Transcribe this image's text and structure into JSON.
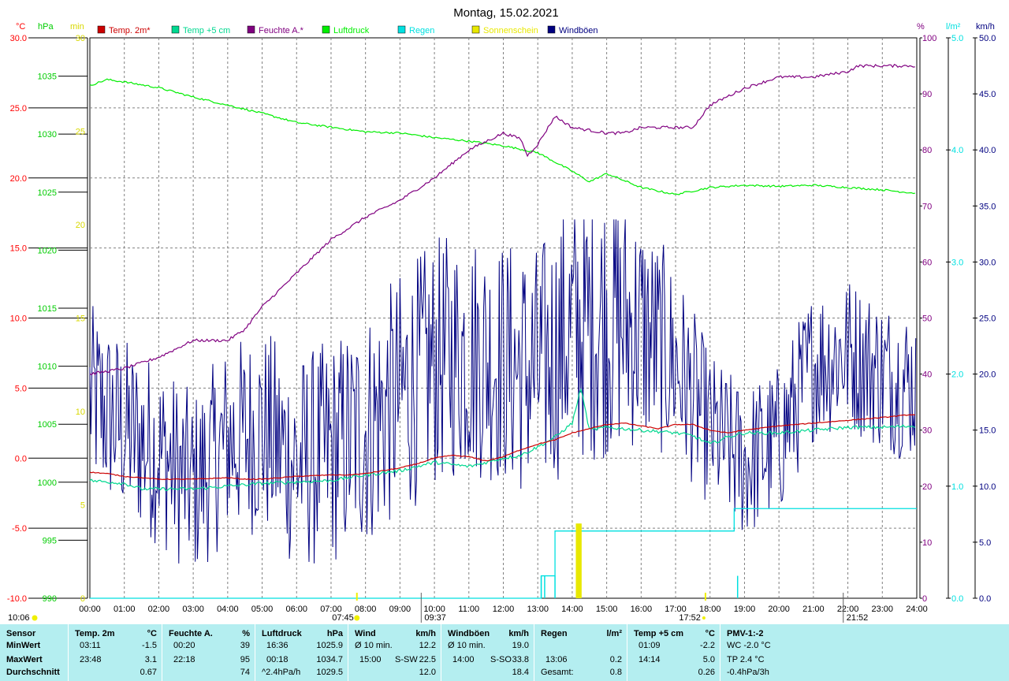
{
  "title": "Montag, 15.02.2021",
  "axes": {
    "temp": {
      "unit": "°C",
      "color": "#ff0000",
      "ticks": [
        30,
        25,
        20,
        15,
        10,
        5,
        0,
        -5,
        -10
      ],
      "labels": [
        "30.0",
        "25.0",
        "20.0",
        "15.0",
        "10.0",
        "5.0",
        "0.0",
        "-5.0",
        "-10.0"
      ]
    },
    "pressure": {
      "unit": "hPa",
      "color": "#00cc00",
      "ticks": [
        1035,
        1030,
        1025,
        1020,
        1015,
        1010,
        1005,
        1000,
        995,
        990
      ],
      "labels": [
        "1035",
        "1030",
        "1025",
        "1020",
        "1015",
        "1010",
        "1005",
        "1000",
        "995",
        "990"
      ]
    },
    "sun": {
      "unit": "min",
      "color": "#e8e800",
      "ticks": [
        30,
        25,
        20,
        15,
        10,
        5,
        0
      ],
      "labels": [
        "30",
        "25",
        "20",
        "15",
        "10",
        "5",
        "0"
      ]
    },
    "humidity": {
      "unit": "%",
      "color": "#800080",
      "ticks": [
        100,
        90,
        80,
        70,
        60,
        50,
        40,
        30,
        20,
        10,
        0
      ],
      "labels": [
        "100",
        "90",
        "80",
        "70",
        "60",
        "50",
        "40",
        "30",
        "20",
        "10",
        "0"
      ]
    },
    "rain": {
      "unit": "l/m²",
      "color": "#00e0e0",
      "ticks": [
        5,
        4,
        3,
        2,
        1,
        0
      ],
      "labels": [
        "5.0",
        "4.0",
        "3.0",
        "2.0",
        "1.0",
        "0.0"
      ]
    },
    "wind": {
      "unit": "km/h",
      "color": "#000080",
      "ticks": [
        50,
        45,
        40,
        35,
        30,
        25,
        20,
        15,
        10,
        5,
        0
      ],
      "labels": [
        "50.0",
        "45.0",
        "40.0",
        "35.0",
        "30.0",
        "25.0",
        "20.0",
        "15.0",
        "10.0",
        "5.0",
        "0.0"
      ]
    }
  },
  "x_labels": [
    "00:00",
    "01:00",
    "02:00",
    "03:00",
    "04:00",
    "05:00",
    "06:00",
    "07:00",
    "08:00",
    "09:00",
    "10:00",
    "11:00",
    "12:00",
    "13:00",
    "14:00",
    "15:00",
    "16:00",
    "17:00",
    "18:00",
    "19:00",
    "20:00",
    "21:00",
    "22:00",
    "23:00",
    "24:00"
  ],
  "sun_events": {
    "moonrise": "10:06",
    "sunrise": "07:45",
    "transit": "09:37",
    "sunset": "17:52",
    "moonset": "21:52"
  },
  "chart_data": {
    "type": "line",
    "x_range": [
      0,
      24
    ],
    "grid": true,
    "legend_position": "top",
    "series": [
      {
        "name": "Temp. 2m*",
        "axis": "temp",
        "color": "#cc0000",
        "points": [
          [
            0,
            -1.0
          ],
          [
            0.5,
            -1.1
          ],
          [
            1,
            -1.3
          ],
          [
            1.5,
            -1.4
          ],
          [
            2,
            -1.5
          ],
          [
            3,
            -1.5
          ],
          [
            4,
            -1.4
          ],
          [
            4.5,
            -1.5
          ],
          [
            5,
            -1.5
          ],
          [
            6,
            -1.3
          ],
          [
            7,
            -1.2
          ],
          [
            7.5,
            -1.2
          ],
          [
            8,
            -1.1
          ],
          [
            8.5,
            -0.9
          ],
          [
            9,
            -0.7
          ],
          [
            9.5,
            -0.4
          ],
          [
            10,
            0.0
          ],
          [
            10.5,
            0.2
          ],
          [
            11,
            0.1
          ],
          [
            11.5,
            -0.2
          ],
          [
            12,
            0.1
          ],
          [
            12.5,
            0.6
          ],
          [
            13,
            1.0
          ],
          [
            13.5,
            1.3
          ],
          [
            14,
            1.8
          ],
          [
            14.5,
            2.1
          ],
          [
            15,
            2.4
          ],
          [
            15.5,
            2.5
          ],
          [
            16,
            2.3
          ],
          [
            16.5,
            2.1
          ],
          [
            17,
            2.4
          ],
          [
            17.5,
            2.4
          ],
          [
            18,
            2.0
          ],
          [
            18.5,
            1.8
          ],
          [
            19,
            2.0
          ],
          [
            20,
            2.3
          ],
          [
            21,
            2.5
          ],
          [
            22,
            2.7
          ],
          [
            23,
            2.9
          ],
          [
            23.8,
            3.1
          ],
          [
            24,
            3.1
          ]
        ]
      },
      {
        "name": "Temp +5 cm",
        "axis": "temp",
        "color": "#00d890",
        "points": [
          [
            0,
            -1.6
          ],
          [
            1,
            -1.8
          ],
          [
            1.5,
            -2.2
          ],
          [
            2,
            -2.2
          ],
          [
            3,
            -2.2
          ],
          [
            4,
            -2.0
          ],
          [
            5,
            -1.8
          ],
          [
            6,
            -1.7
          ],
          [
            7,
            -1.6
          ],
          [
            8,
            -1.2
          ],
          [
            9,
            -0.9
          ],
          [
            10,
            -0.3
          ],
          [
            11,
            -0.6
          ],
          [
            12,
            0.0
          ],
          [
            12.5,
            0.2
          ],
          [
            13,
            0.8
          ],
          [
            13.5,
            1.5
          ],
          [
            14,
            2.5
          ],
          [
            14.25,
            5.0
          ],
          [
            14.5,
            2.0
          ],
          [
            15,
            2.2
          ],
          [
            16,
            2.0
          ],
          [
            17,
            1.8
          ],
          [
            17.5,
            1.6
          ],
          [
            18,
            1.0
          ],
          [
            18.5,
            1.5
          ],
          [
            19,
            1.8
          ],
          [
            20,
            1.8
          ],
          [
            21,
            2.0
          ],
          [
            22,
            2.2
          ],
          [
            23,
            2.2
          ],
          [
            24,
            2.3
          ]
        ]
      },
      {
        "name": "Feuchte A.*",
        "axis": "humidity",
        "color": "#800080",
        "points": [
          [
            0,
            40
          ],
          [
            1,
            41
          ],
          [
            2,
            43
          ],
          [
            3,
            46
          ],
          [
            4,
            46
          ],
          [
            4.5,
            48
          ],
          [
            5,
            52
          ],
          [
            6,
            58
          ],
          [
            7,
            64
          ],
          [
            8,
            68
          ],
          [
            9,
            71
          ],
          [
            10,
            75
          ],
          [
            11,
            80
          ],
          [
            12,
            83
          ],
          [
            12.5,
            82
          ],
          [
            12.7,
            79
          ],
          [
            13,
            81
          ],
          [
            13.5,
            86
          ],
          [
            14,
            84
          ],
          [
            15,
            83
          ],
          [
            15.5,
            83
          ],
          [
            16,
            84
          ],
          [
            17,
            84
          ],
          [
            17.5,
            84
          ],
          [
            18,
            88
          ],
          [
            19,
            91
          ],
          [
            20,
            93
          ],
          [
            21,
            93
          ],
          [
            22,
            94
          ],
          [
            22.3,
            95
          ],
          [
            24,
            95
          ]
        ]
      },
      {
        "name": "Luftdruck",
        "axis": "pressure",
        "color": "#00ee00",
        "points": [
          [
            0,
            1034.2
          ],
          [
            0.5,
            1034.7
          ],
          [
            1,
            1034.5
          ],
          [
            2,
            1034.0
          ],
          [
            3,
            1033.2
          ],
          [
            4,
            1032.5
          ],
          [
            5,
            1031.8
          ],
          [
            6,
            1031.0
          ],
          [
            7,
            1030.6
          ],
          [
            8,
            1030.2
          ],
          [
            9,
            1030.1
          ],
          [
            10,
            1029.7
          ],
          [
            11,
            1029.4
          ],
          [
            12,
            1029.0
          ],
          [
            13,
            1028.4
          ],
          [
            14,
            1026.8
          ],
          [
            14.5,
            1025.9
          ],
          [
            15,
            1026.6
          ],
          [
            16,
            1025.4
          ],
          [
            17,
            1024.8
          ],
          [
            18,
            1025.4
          ],
          [
            19,
            1025.6
          ],
          [
            20,
            1025.5
          ],
          [
            21,
            1025.6
          ],
          [
            22,
            1025.4
          ],
          [
            23,
            1025.2
          ],
          [
            24,
            1024.9
          ]
        ]
      },
      {
        "name": "Regen",
        "axis": "rain",
        "color": "#00e0e0",
        "cumulative": [
          [
            0,
            0
          ],
          [
            13.1,
            0
          ],
          [
            13.1,
            0.2
          ],
          [
            13.5,
            0.2
          ],
          [
            13.5,
            0.6
          ],
          [
            18.7,
            0.6
          ],
          [
            18.7,
            0.8
          ],
          [
            24,
            0.8
          ]
        ],
        "spikes": [
          [
            13.1,
            0.2
          ],
          [
            13.2,
            0.2
          ],
          [
            13.5,
            0.2
          ],
          [
            18.8,
            0.2
          ]
        ]
      },
      {
        "name": "Sonnenschein",
        "axis": "sun",
        "color": "#e8e800",
        "bars": [
          [
            14.15,
            4
          ],
          [
            14.2,
            4
          ],
          [
            14.25,
            4
          ]
        ]
      },
      {
        "name": "Windböen",
        "axis": "wind",
        "color": "#000080",
        "baseline": [
          [
            0,
            18
          ],
          [
            1,
            15
          ],
          [
            2,
            13
          ],
          [
            3,
            10
          ],
          [
            4,
            14
          ],
          [
            5,
            15
          ],
          [
            6,
            12
          ],
          [
            7,
            13
          ],
          [
            8,
            15
          ],
          [
            9,
            18
          ],
          [
            10,
            21
          ],
          [
            11,
            22
          ],
          [
            12,
            21
          ],
          [
            13,
            20
          ],
          [
            14,
            24
          ],
          [
            15,
            25
          ],
          [
            16,
            24
          ],
          [
            17,
            21
          ],
          [
            18,
            15
          ],
          [
            19,
            12
          ],
          [
            20,
            14
          ],
          [
            21,
            21
          ],
          [
            22,
            22
          ],
          [
            23,
            20
          ],
          [
            24,
            19
          ]
        ],
        "amplitude": [
          [
            0,
            6
          ],
          [
            3,
            6
          ],
          [
            6,
            7
          ],
          [
            9,
            8
          ],
          [
            12,
            8
          ],
          [
            15,
            9
          ],
          [
            18,
            5
          ],
          [
            20,
            5
          ],
          [
            24,
            5
          ]
        ],
        "max": 33.8
      }
    ]
  },
  "legend": [
    {
      "label": "Temp. 2m*",
      "color": "#cc0000"
    },
    {
      "label": "Temp +5 cm",
      "color": "#00d890"
    },
    {
      "label": "Feuchte A.*",
      "color": "#800080"
    },
    {
      "label": "Luftdruck",
      "color": "#00ee00"
    },
    {
      "label": "Regen",
      "color": "#00e0e0"
    },
    {
      "label": "Sonnenschein",
      "color": "#e8e800"
    },
    {
      "label": "Windböen",
      "color": "#000080"
    }
  ],
  "stats": {
    "labels": {
      "sensor": "Sensor",
      "min": "MinWert",
      "max": "MaxWert",
      "avg": "Durchschnitt"
    },
    "temp2m": {
      "title": "Temp. 2m",
      "unit": "°C",
      "min_time": "03:11",
      "min_val": "-1.5",
      "max_time": "23:48",
      "max_val": "3.1",
      "avg": "0.67"
    },
    "humidity": {
      "title": "Feuchte A.",
      "unit": "%",
      "min_time": "00:20",
      "min_val": "39",
      "max_time": "22:18",
      "max_val": "95",
      "avg": "74"
    },
    "pressure": {
      "title": "Luftdruck",
      "unit": "hPa",
      "min_time": "16:36",
      "min_val": "1025.9",
      "max_time": "00:18",
      "max_val": "1034.7",
      "avg_label": "^2.4hPa/h",
      "avg": "1029.5"
    },
    "wind": {
      "title": "Wind",
      "unit": "km/h",
      "min_label": "Ø 10 min.",
      "min_val": "12.2",
      "max_time": "15:00",
      "max_dir": "S-SW",
      "max_val": "22.5",
      "avg": "12.0"
    },
    "gusts": {
      "title": "Windböen",
      "unit": "km/h",
      "min_label": "Ø 10 min.",
      "min_val": "19.0",
      "max_time": "14:00",
      "max_dir": "S-SO",
      "max_val": "33.8",
      "avg": "18.4"
    },
    "rain": {
      "title": "Regen",
      "unit": "l/m²",
      "max_time": "13:06",
      "max_val": "0.2",
      "total_label": "Gesamt:",
      "total": "0.8"
    },
    "temp5cm": {
      "title": "Temp +5 cm",
      "unit": "°C",
      "min_time": "01:09",
      "min_val": "-2.2",
      "max_time": "14:14",
      "max_val": "5.0",
      "avg": "0.26"
    },
    "pmv": {
      "title": "PMV-1:-2",
      "min": "WC -2.0 °C",
      "max": "TP 2.4 °C",
      "avg": "-0.4hPa/3h"
    }
  }
}
